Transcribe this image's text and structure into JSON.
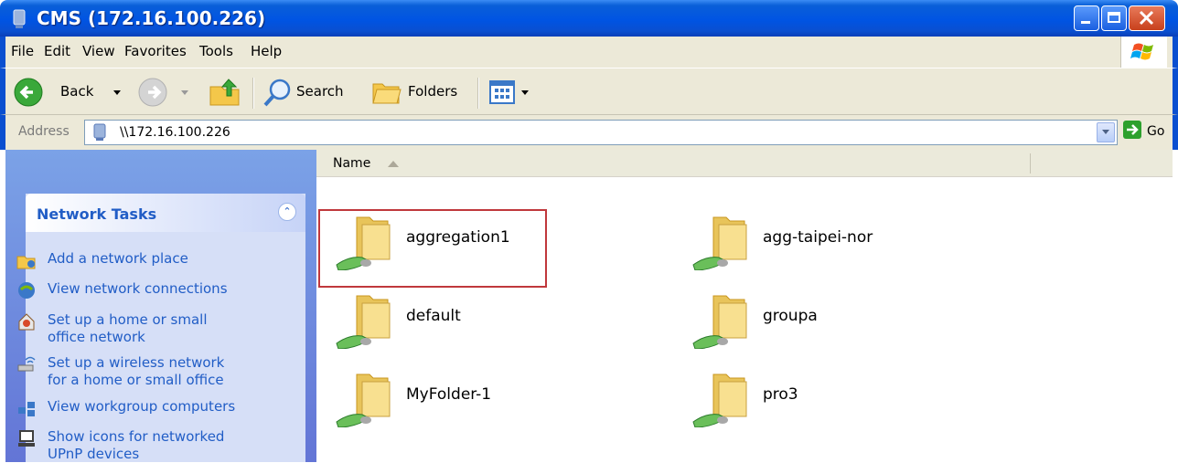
{
  "window": {
    "title": "CMS (172.16.100.226)",
    "controls": [
      "minimize",
      "maximize",
      "close"
    ]
  },
  "menu": [
    "File",
    "Edit",
    "View",
    "Favorites",
    "Tools",
    "Help"
  ],
  "toolbar": {
    "back_label": "Back",
    "search_label": "Search",
    "folders_label": "Folders"
  },
  "address": {
    "label": "Address",
    "value": "\\\\172.16.100.226",
    "go_label": "Go"
  },
  "left_pane": {
    "section_title": "Network Tasks",
    "tasks": [
      {
        "label": "Add a network place",
        "icon": "network-place-icon"
      },
      {
        "label": "View network connections",
        "icon": "network-connections-icon"
      },
      {
        "label": "Set up a home or small\noffice network",
        "icon": "home-network-icon"
      },
      {
        "label": "Set up a wireless network\nfor a home or small office",
        "icon": "wireless-network-icon"
      },
      {
        "label": "View workgroup computers",
        "icon": "workgroup-icon"
      },
      {
        "label": "Show icons for networked\nUPnP devices",
        "icon": "upnp-icon"
      }
    ]
  },
  "list": {
    "column_name": "Name",
    "items": [
      {
        "name": "aggregation1",
        "selected": true
      },
      {
        "name": "agg-taipei-nor",
        "selected": false
      },
      {
        "name": "default",
        "selected": false
      },
      {
        "name": "groupa",
        "selected": false
      },
      {
        "name": "MyFolder-1",
        "selected": false
      },
      {
        "name": "pro3",
        "selected": false
      }
    ]
  },
  "colors": {
    "titlebar": "#0054e3",
    "highlight_box": "#c0383c",
    "task_link": "#215dc6"
  }
}
